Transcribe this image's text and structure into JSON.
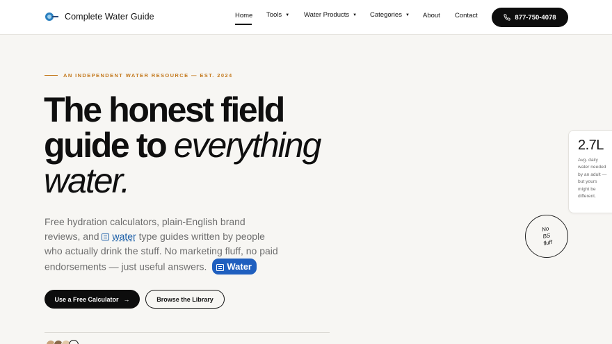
{
  "header": {
    "brand": "Complete Water Guide",
    "logo_icon": "water-logo-icon",
    "nav": [
      {
        "label": "Home",
        "dropdown": false,
        "active": true
      },
      {
        "label": "Tools",
        "dropdown": true
      },
      {
        "label": "Water Products",
        "dropdown": true
      },
      {
        "label": "Categories",
        "dropdown": true
      },
      {
        "label": "About",
        "dropdown": false
      },
      {
        "label": "Contact",
        "dropdown": false
      }
    ],
    "phone": "877-750-4078",
    "phone_icon": "phone-icon"
  },
  "hero": {
    "eyebrow": "AN INDEPENDENT WATER RESOURCE — EST. 2024",
    "headline_line1": "The honest field",
    "headline_line2_plain": "guide to ",
    "headline_line2_italic": "everything",
    "headline_line3_italic": " water.",
    "lead_part1": "Free hydration calculators, plain-English brand reviews, and ",
    "lead_link": "water",
    "lead_part2": " type guides written by people who actually drink the stuff. No marketing fluff, no paid endorsements — just useful answers.",
    "pill_label": "Water",
    "primary_button": "Use a Free Calculator",
    "primary_arrow": "→",
    "secondary_button": "Browse the Library"
  },
  "stat_card": {
    "value": "2.7L",
    "caption": "Avg. daily water needed by an adult — but yours might be different."
  },
  "badge": {
    "line1": "No",
    "line2": "BS",
    "line3": "fluff"
  },
  "colors": {
    "accent_orange": "#c47a1f",
    "link_blue": "#1c5fa8",
    "pill_blue": "#1f5fbf",
    "ink": "#0d0d0d",
    "background": "#f7f6f3"
  }
}
